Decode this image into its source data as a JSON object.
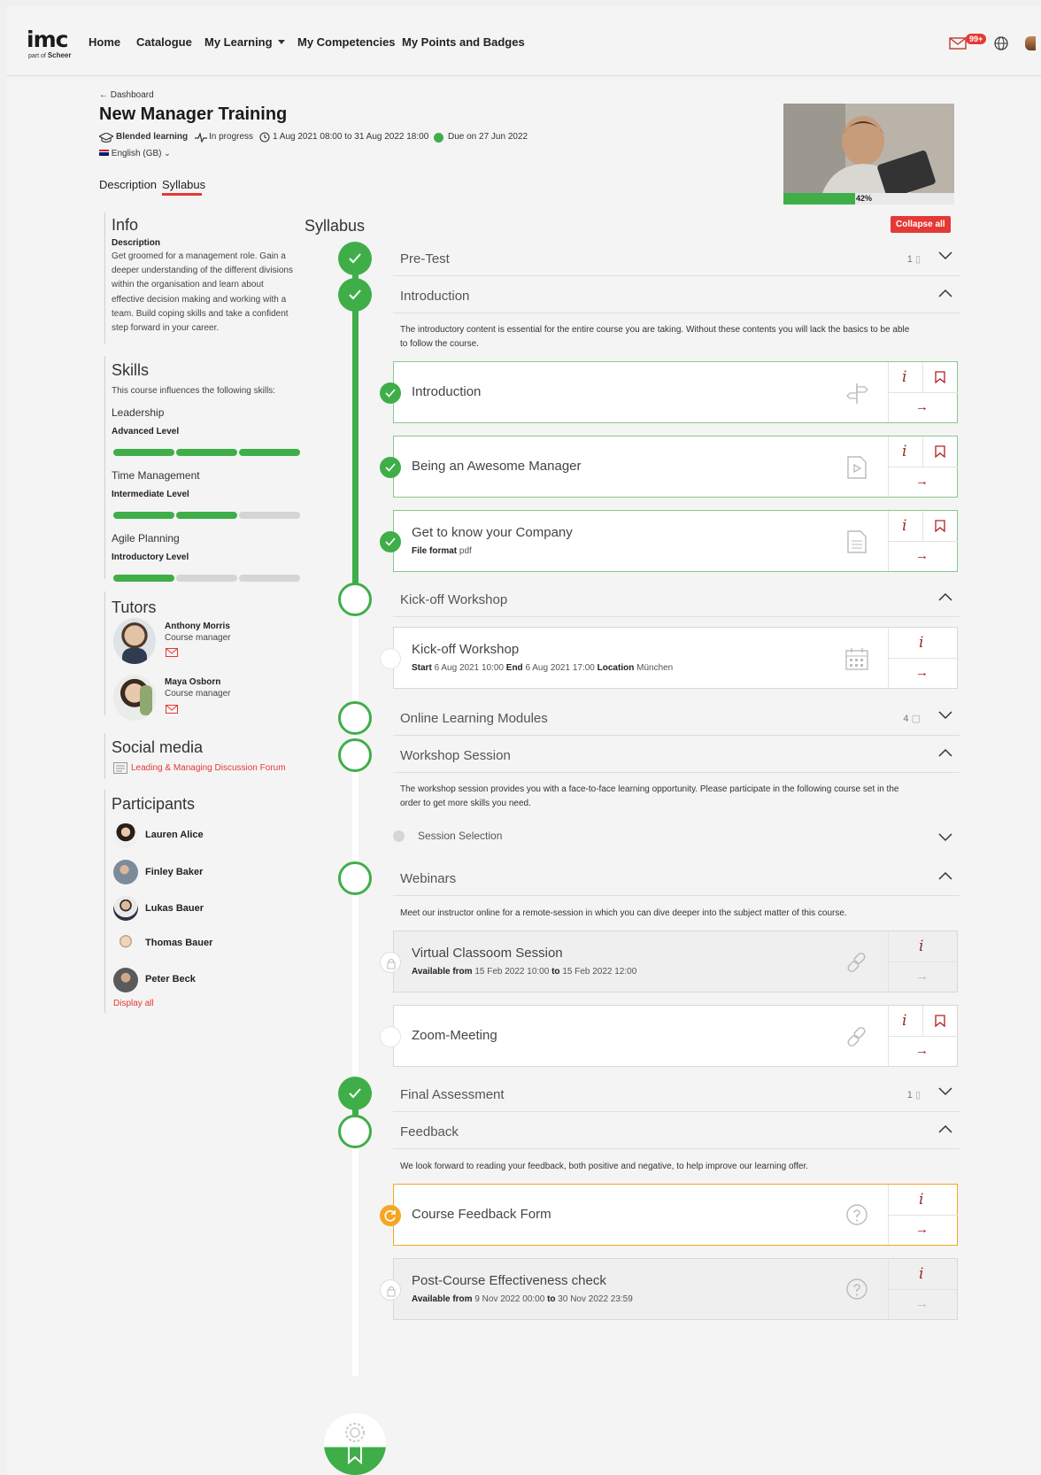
{
  "header": {
    "logo": "imc",
    "logo_sub_prefix": "part of",
    "logo_sub_brand": "Scheer",
    "nav": [
      "Home",
      "Catalogue",
      "My Learning",
      "My Competencies",
      "My Points and Badges"
    ],
    "notifications_badge": "99+"
  },
  "course": {
    "back_link": "← Dashboard",
    "title": "New Manager Training",
    "type": "Blended learning",
    "status": "In progress",
    "period": "1 Aug 2021 08:00 to 31 Aug 2022 18:00",
    "due": "Due on 27 Jun 2022",
    "language": "English (GB)",
    "tabs": [
      "Description",
      "Syllabus"
    ],
    "active_tab": "Syllabus",
    "progress_label": "42%",
    "progress_value": 0.42
  },
  "info": {
    "heading": "Info",
    "desc_label": "Description",
    "desc_lines": [
      "Get groomed for a management role. Gain a",
      "deeper understanding of the different divisions",
      "within the organisation and learn about",
      "effective decision making and working with a",
      "team. Build coping skills and take a confident",
      "step forward in your career."
    ]
  },
  "skills": {
    "heading": "Skills",
    "intro": "This course influences the following skills:",
    "items": [
      {
        "name": "Leadership",
        "level": "Advanced Level",
        "filled": 3
      },
      {
        "name": "Time Management",
        "level": "Intermediate Level",
        "filled": 2
      },
      {
        "name": "Agile Planning",
        "level": "Introductory Level",
        "filled": 1
      }
    ]
  },
  "tutors": {
    "heading": "Tutors",
    "items": [
      {
        "name": "Anthony Morris",
        "role": "Course manager"
      },
      {
        "name": "Maya Osborn",
        "role": "Course manager"
      }
    ]
  },
  "social": {
    "heading": "Social media",
    "forum": "Leading & Managing Discussion Forum"
  },
  "participants": {
    "heading": "Participants",
    "items": [
      "Lauren Alice",
      "Finley Baker",
      "Lukas Bauer",
      "Thomas Bauer",
      "Peter Beck"
    ],
    "display_all": "Display all"
  },
  "syllabus": {
    "heading": "Syllabus",
    "collapse_all": "Collapse all",
    "sections": [
      {
        "label": "Pre-Test",
        "count": "1"
      },
      {
        "label": "Introduction",
        "desc": [
          "The introductory content is essential for the entire course you are taking. Without these contents you will lack the basics to be able",
          "to follow the course."
        ]
      },
      {
        "label": "Kick-off Workshop"
      },
      {
        "label": "Online Learning Modules",
        "count": "4"
      },
      {
        "label": "Workshop Session",
        "desc": [
          "The workshop session provides you with a face-to-face learning opportunity. Please participate in the following course set in the",
          "order to get more skills you need."
        ],
        "sub": "Session Selection"
      },
      {
        "label": "Webinars",
        "desc": [
          "Meet our instructor online for a remote-session in which you can dive deeper into the subject matter of this course."
        ]
      },
      {
        "label": "Final Assessment",
        "count": "1"
      },
      {
        "label": "Feedback",
        "desc": [
          "We look forward to reading your feedback, both positive and negative, to help improve our learning offer."
        ]
      }
    ],
    "cards": {
      "intro": {
        "title": "Introduction"
      },
      "manager": {
        "title": "Being an Awesome Manager"
      },
      "company": {
        "title": "Get to know your Company",
        "meta_label": "File format",
        "meta_value": "pdf"
      },
      "kickoff": {
        "title": "Kick-off Workshop",
        "start_label": "Start",
        "start": "6 Aug 2021 10:00",
        "end_label": "End",
        "end": "6 Aug 2021 17:00",
        "loc_label": "Location",
        "loc": "München"
      },
      "virtual": {
        "title": "Virtual Classoom Session",
        "from_label": "Available from",
        "from": "15 Feb 2022 10:00",
        "to_label": "to",
        "to": "15 Feb 2022 12:00"
      },
      "zoom": {
        "title": "Zoom-Meeting"
      },
      "feedbackform": {
        "title": "Course Feedback Form"
      },
      "postcourse": {
        "title": "Post-Course Effectiveness check",
        "from_label": "Available from",
        "from": "9 Nov 2022 00:00",
        "to_label": "to",
        "to": "30 Nov 2022 23:59"
      }
    },
    "info_glyph": "i",
    "arrow_glyph": "→"
  },
  "colors": {
    "accent": "#e53935",
    "success": "#3fae49",
    "warning": "#f5a623"
  }
}
